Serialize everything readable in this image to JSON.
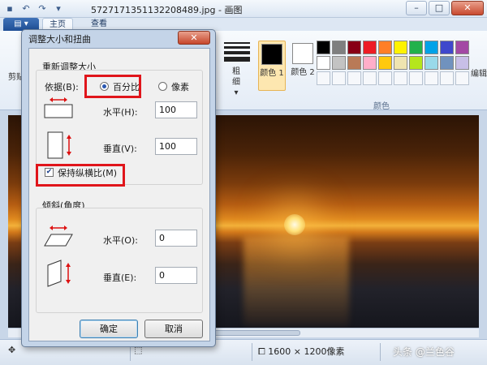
{
  "window": {
    "title": "5727171351132208489.jpg - 画图",
    "controls": {
      "minimize": "–",
      "maximize": "□",
      "close": "✕"
    }
  },
  "quick_access": {
    "save": "▪",
    "undo": "↶",
    "redo": "↷",
    "more": "▾"
  },
  "tabs": {
    "app_menu": "▤ ▾",
    "home": "主页",
    "view": "查看"
  },
  "ribbon": {
    "cut_label": "剪贴",
    "thickness_label": "粗细",
    "thickness_arrow": "▾",
    "color1_label": "颜色 1",
    "color2_label": "颜色 2",
    "palette_label": "颜色",
    "edit_colors_label": "编辑",
    "color1_value": "#000000",
    "color2_value": "#ffffff",
    "palette": [
      "#000000",
      "#7f7f7f",
      "#880015",
      "#ed1c24",
      "#ff7f27",
      "#fff200",
      "#22b14c",
      "#00a2e8",
      "#3f48cc",
      "#a349a4",
      "#ffffff",
      "#c3c3c3",
      "#b97a57",
      "#ffaec9",
      "#ffc90e",
      "#efe4b0",
      "#b5e61d",
      "#99d9ea",
      "#7092be",
      "#c8bfe7"
    ]
  },
  "dialog": {
    "title": "调整大小和扭曲",
    "close_icon": "✕",
    "resize": {
      "group_title": "重新调整大小",
      "by_label": "依据(B):",
      "percent_label": "百分比",
      "pixels_label": "像素",
      "selected": "percent",
      "horizontal_label": "水平(H):",
      "horizontal_value": "100",
      "vertical_label": "垂直(V):",
      "vertical_value": "100",
      "keep_ratio_label": "保持纵横比(M)",
      "keep_ratio_checked": true
    },
    "skew": {
      "group_title": "倾斜(角度)",
      "horizontal_label": "水平(O):",
      "horizontal_value": "0",
      "vertical_label": "垂直(E):",
      "vertical_value": "0"
    },
    "ok_label": "确定",
    "cancel_label": "取消",
    "highlight_color": "#e0151b"
  },
  "statusbar": {
    "size_text": "1600 × 1200像素",
    "watermark": "头条 @兰色谷"
  }
}
